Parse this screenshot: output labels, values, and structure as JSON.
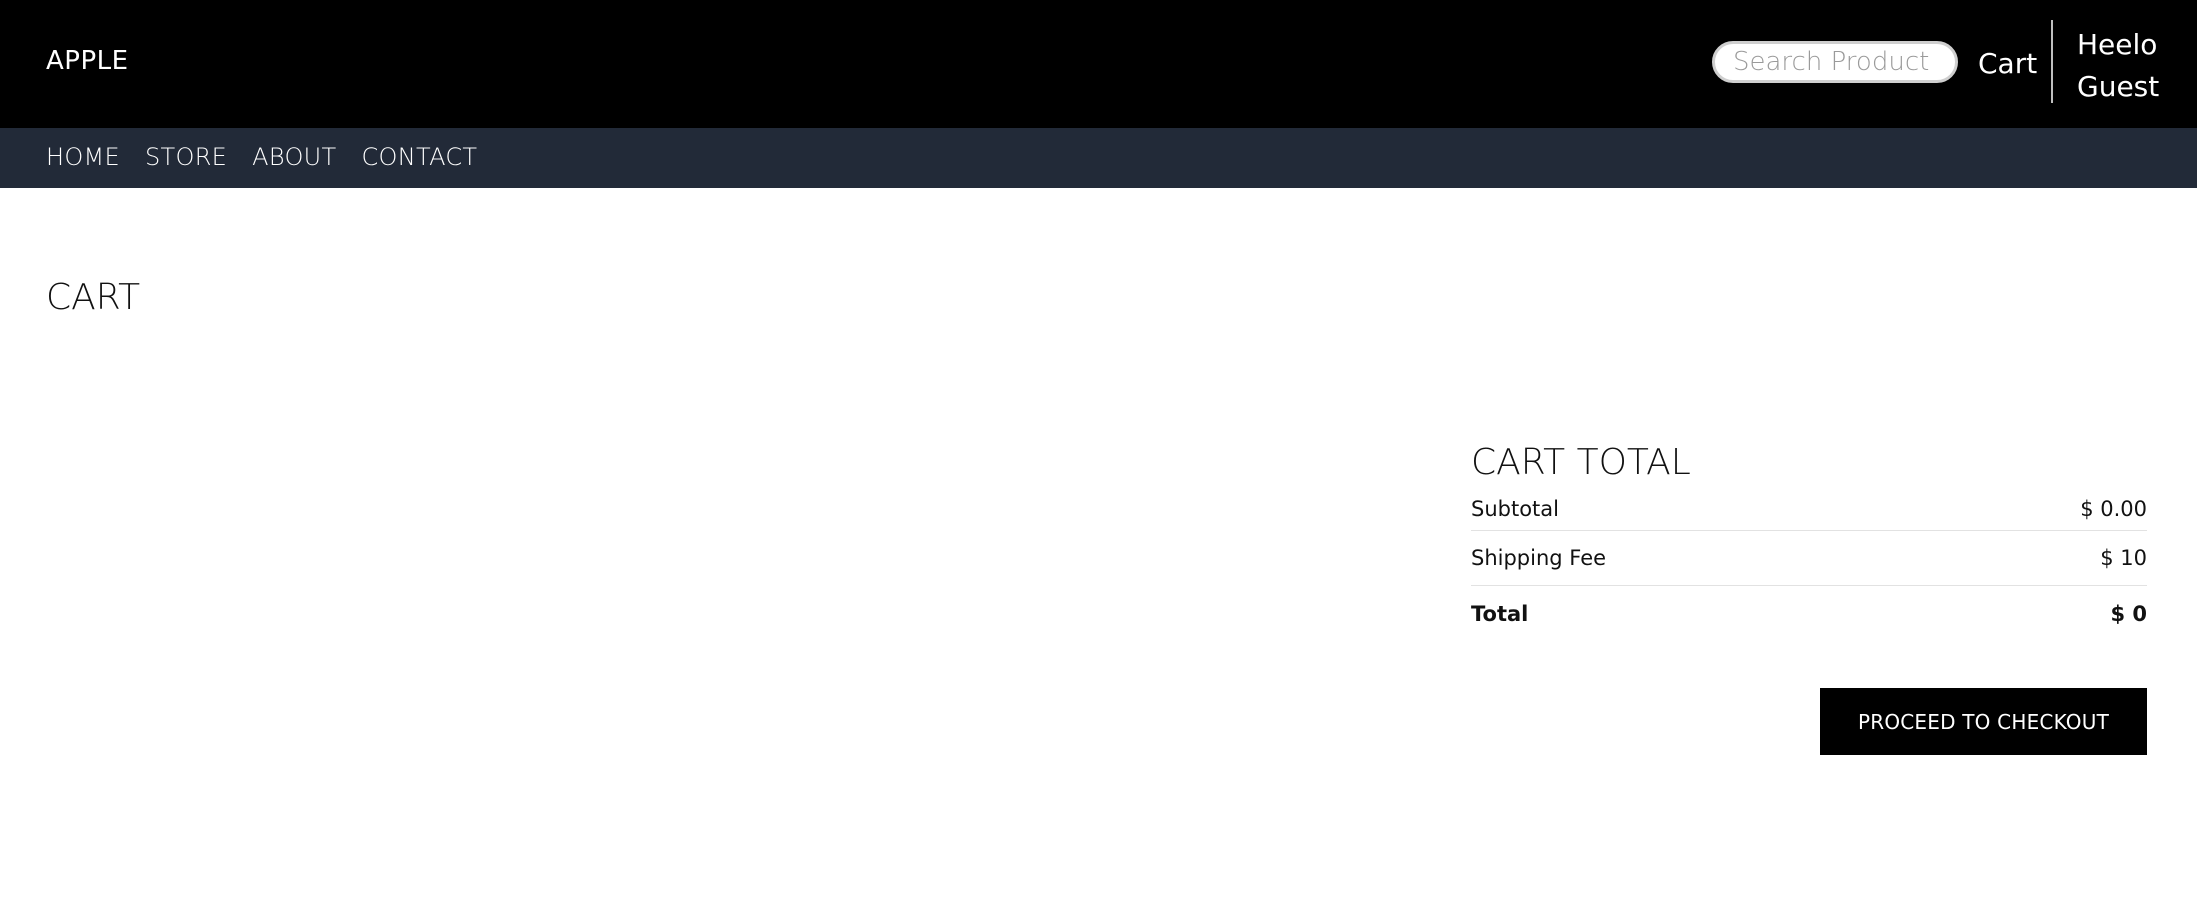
{
  "header": {
    "brand": "APPLE",
    "search_placeholder": "Search Product",
    "cart_label": "Cart",
    "greeting_line1": "Heelo",
    "greeting_line2": "Guest"
  },
  "nav": {
    "items": [
      {
        "label": "HOME"
      },
      {
        "label": "STORE"
      },
      {
        "label": "ABOUT"
      },
      {
        "label": "CONTACT"
      }
    ]
  },
  "page": {
    "title": "CART"
  },
  "cart_total": {
    "heading": "CART TOTAL",
    "subtotal_label": "Subtotal",
    "subtotal_value": "$ 0.00",
    "shipping_label": "Shipping Fee",
    "shipping_value": "$ 10",
    "total_label": "Total",
    "total_value": "$ 0",
    "checkout_label": "PROCEED TO CHECKOUT"
  }
}
